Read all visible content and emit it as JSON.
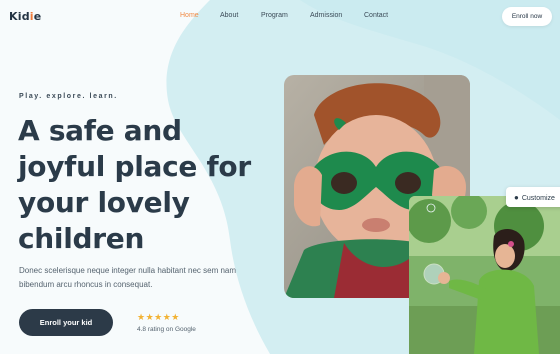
{
  "header": {
    "logo": {
      "main": "Kid",
      "accent": "i",
      "end": "e"
    },
    "nav": [
      {
        "label": "Home",
        "active": true
      },
      {
        "label": "About",
        "active": false
      },
      {
        "label": "Program",
        "active": false
      },
      {
        "label": "Admission",
        "active": false
      },
      {
        "label": "Contact",
        "active": false
      }
    ],
    "enroll_button": "Enroll now"
  },
  "hero": {
    "tagline": "Play. explore. learn.",
    "title": "A safe and joyful place for your lovely children",
    "description": "Donec scelerisque neque integer nulla habitant nec sem nam bibendum arcu rhoncus in consequat.",
    "cta": "Enroll your kid",
    "stars": "★★★★★",
    "rating_text": "4.8 rating on Google"
  },
  "customize": {
    "label": "Customize"
  },
  "colors": {
    "accent": "#f08a45",
    "dark": "#2c3a48",
    "blob": "#d3eef2",
    "star": "#f2b233"
  }
}
